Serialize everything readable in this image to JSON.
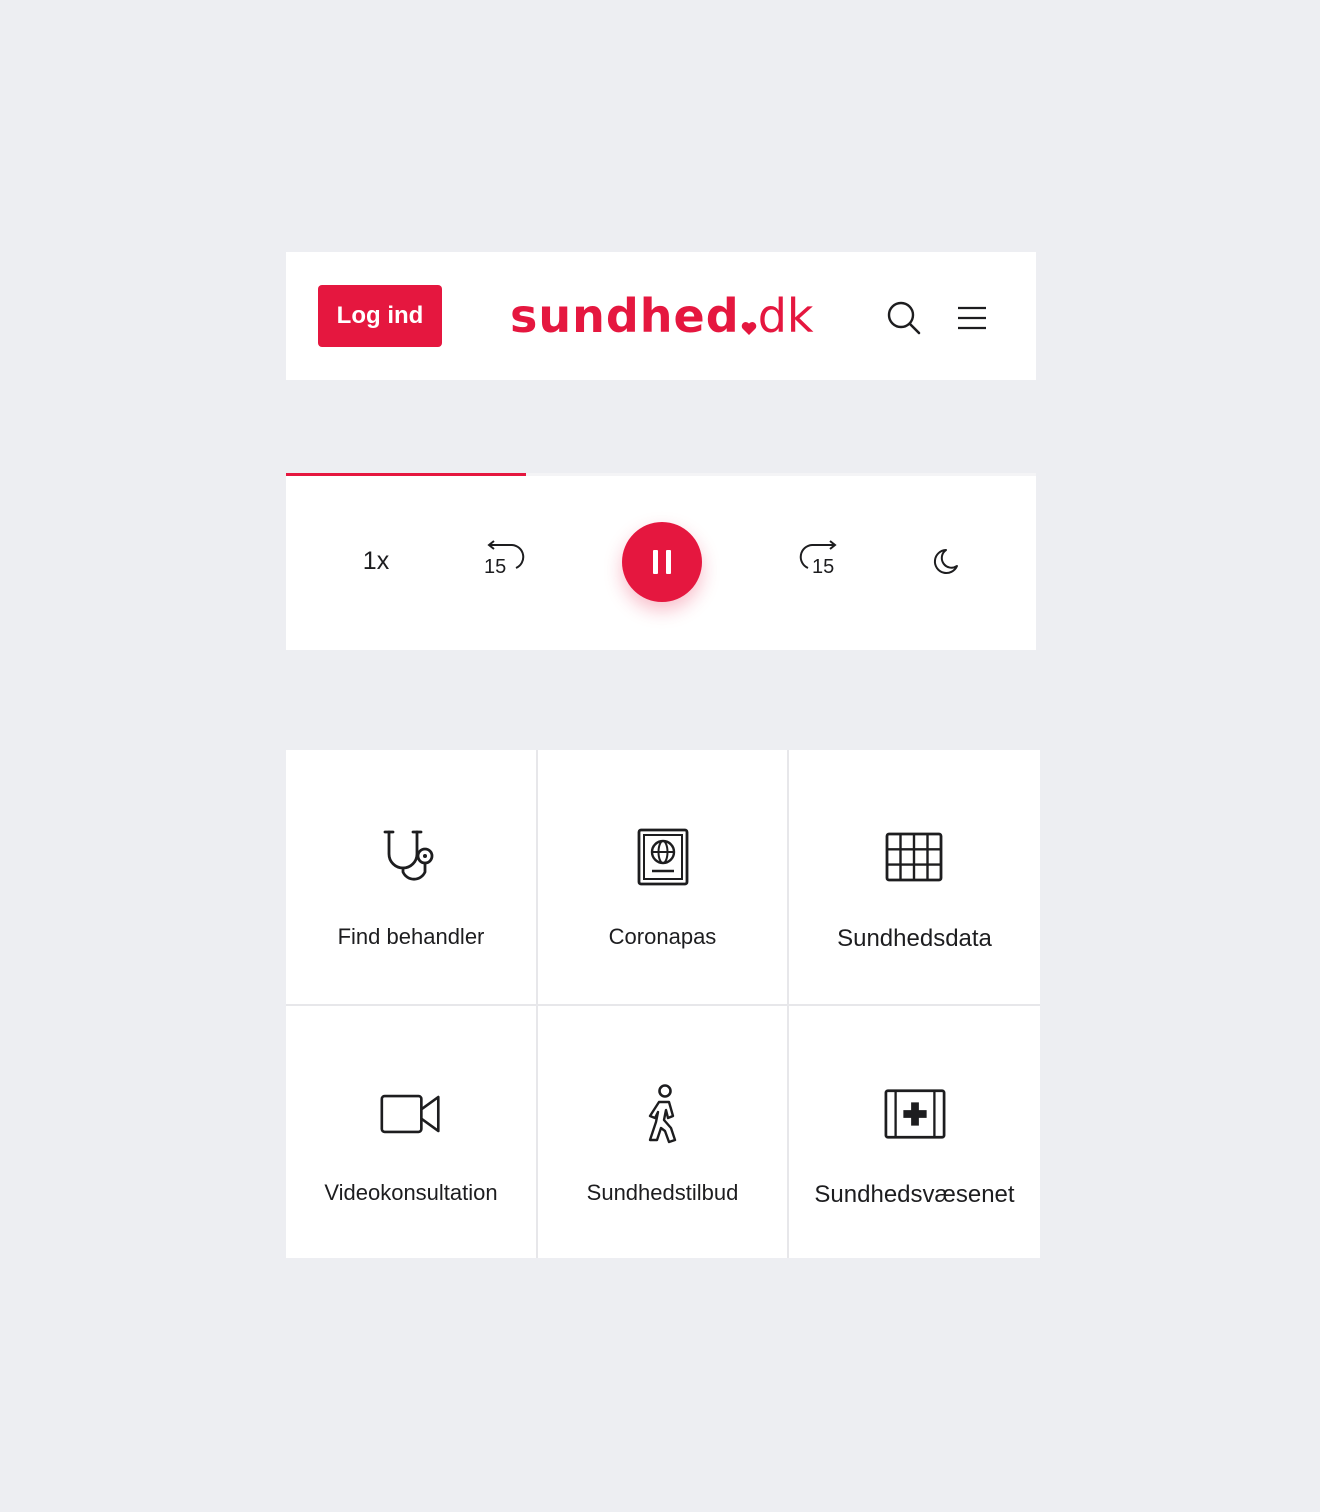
{
  "colors": {
    "brand": "#e5173f",
    "background": "#edeef2",
    "text": "#1d1d1f"
  },
  "header": {
    "login_label": "Log ind",
    "logo": {
      "main": "sundhed",
      "tld": "dk"
    },
    "search_icon": "search-icon",
    "menu_icon": "hamburger-menu-icon"
  },
  "player": {
    "progress": 0.32,
    "speed_label": "1x",
    "rewind": {
      "icon": "rewind-15-icon",
      "seconds": "15"
    },
    "pause_icon": "pause-icon",
    "forward": {
      "icon": "forward-15-icon",
      "seconds": "15"
    },
    "sleep_icon": "moon-icon"
  },
  "tiles": [
    {
      "label": "Find behandler",
      "icon": "stethoscope-icon"
    },
    {
      "label": "Coronapas",
      "icon": "passport-icon"
    },
    {
      "label": "Sundhedsdata",
      "icon": "grid-table-icon"
    },
    {
      "label": "Videokonsultation",
      "icon": "video-camera-icon"
    },
    {
      "label": "Sundhedstilbud",
      "icon": "walking-person-icon"
    },
    {
      "label": "Sundhedsvæsenet",
      "icon": "first-aid-kit-icon"
    }
  ]
}
